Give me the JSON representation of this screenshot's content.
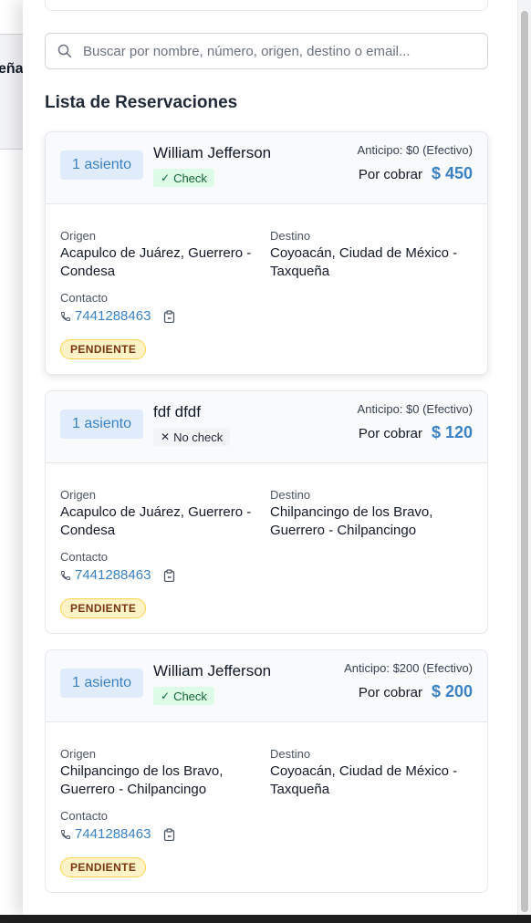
{
  "background": {
    "partial_text": "eña"
  },
  "search": {
    "placeholder": "Buscar por nombre, número, origen, destino o email..."
  },
  "section_title": "Lista de Reservaciones",
  "labels": {
    "origin": "Origen",
    "destination": "Destino",
    "contact": "Contacto",
    "por_cobrar": "Por cobrar"
  },
  "colors": {
    "accent_blue": "#3b82c4",
    "check_green": "#dcfce7",
    "pending_yellow": "#fef3c7"
  },
  "reservations": [
    {
      "seats": "1 asiento",
      "name": "William Jefferson",
      "check": "Check",
      "check_icon": "checkmark-icon",
      "anticipo": "Anticipo: $0 (Efectivo)",
      "amount": "$ 450",
      "origin": "Acapulco de Juárez, Guerrero - Condesa",
      "destination": "Coyoacán, Ciudad de México - Taxqueña",
      "phone": "7441288463",
      "status": "PENDIENTE"
    },
    {
      "seats": "1 asiento",
      "name": "fdf dfdf",
      "check": "No check",
      "check_icon": "x-icon",
      "anticipo": "Anticipo: $0 (Efectivo)",
      "amount": "$ 120",
      "origin": "Acapulco de Juárez, Guerrero - Condesa",
      "destination": "Chilpancingo de los Bravo, Guerrero - Chilpancingo",
      "phone": "7441288463",
      "status": "PENDIENTE"
    },
    {
      "seats": "1 asiento",
      "name": "William Jefferson",
      "check": "Check",
      "check_icon": "checkmark-icon",
      "anticipo": "Anticipo: $200 (Efectivo)",
      "amount": "$ 200",
      "origin": "Chilpancingo de los Bravo, Guerrero - Chilpancingo",
      "destination": "Coyoacán, Ciudad de México - Taxqueña",
      "phone": "7441288463",
      "status": "PENDIENTE"
    }
  ]
}
